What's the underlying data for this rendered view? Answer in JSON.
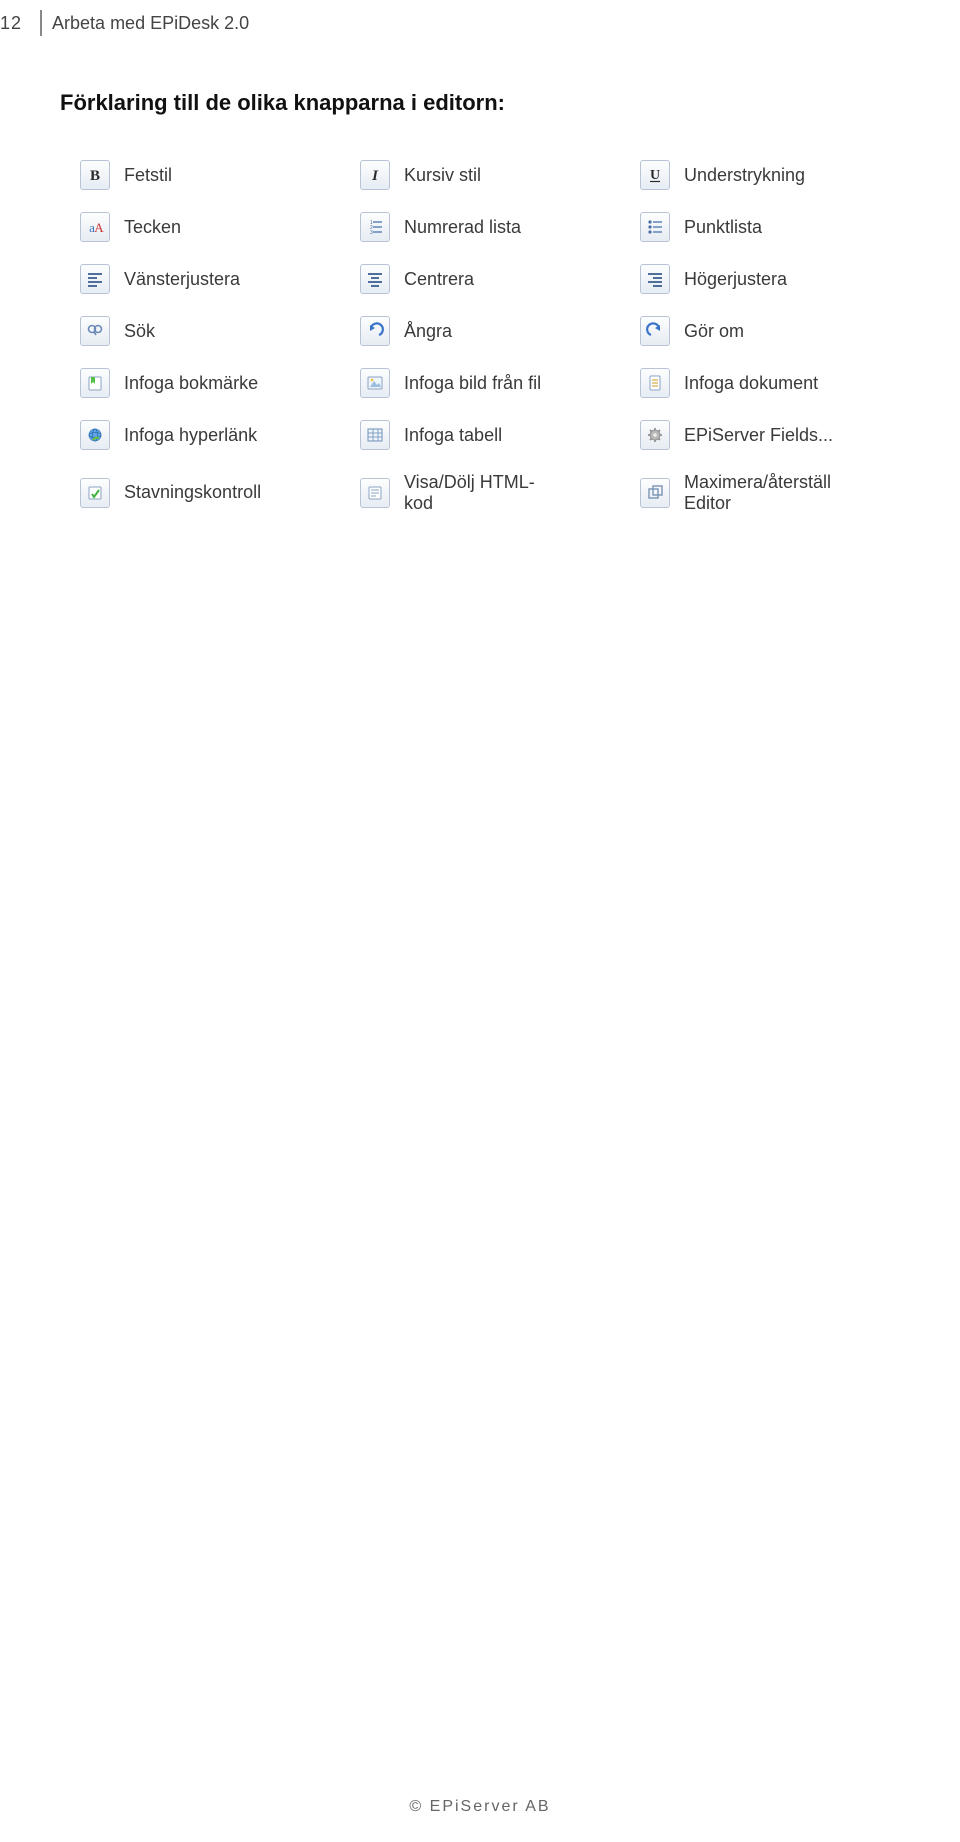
{
  "header": {
    "page_number": "12",
    "title": "Arbeta med EPiDesk 2.0"
  },
  "section_heading": "Förklaring till de olika knapparna i editorn:",
  "rows": [
    {
      "c1": {
        "icon": "bold-icon",
        "label": "Fetstil"
      },
      "c2": {
        "icon": "italic-icon",
        "label": "Kursiv stil"
      },
      "c3": {
        "icon": "underline-icon",
        "label": "Understrykning"
      }
    },
    {
      "c1": {
        "icon": "font-icon",
        "label": "Tecken"
      },
      "c2": {
        "icon": "ordered-list-icon",
        "label": "Numrerad lista"
      },
      "c3": {
        "icon": "bullet-list-icon",
        "label": "Punktlista"
      }
    },
    {
      "c1": {
        "icon": "align-left-icon",
        "label": "Vänsterjustera"
      },
      "c2": {
        "icon": "align-center-icon",
        "label": "Centrera"
      },
      "c3": {
        "icon": "align-right-icon",
        "label": "Högerjustera"
      }
    },
    {
      "c1": {
        "icon": "search-icon",
        "label": "Sök"
      },
      "c2": {
        "icon": "undo-icon",
        "label": "Ångra"
      },
      "c3": {
        "icon": "redo-icon",
        "label": "Gör om"
      }
    },
    {
      "c1": {
        "icon": "bookmark-icon",
        "label": "Infoga bokmärke"
      },
      "c2": {
        "icon": "image-icon",
        "label": "Infoga bild från fil"
      },
      "c3": {
        "icon": "document-icon",
        "label": "Infoga dokument"
      }
    },
    {
      "c1": {
        "icon": "hyperlink-icon",
        "label": "Infoga hyperlänk"
      },
      "c2": {
        "icon": "table-icon",
        "label": "Infoga tabell"
      },
      "c3": {
        "icon": "gear-icon",
        "label": "EPiServer Fields..."
      }
    },
    {
      "c1": {
        "icon": "spellcheck-icon",
        "label": "Stavningskontroll"
      },
      "c2": {
        "icon": "html-toggle-icon",
        "label": "Visa/Dölj HTML-\nkod"
      },
      "c3": {
        "icon": "maximize-icon",
        "label": "Maximera/återställ\nEditor"
      }
    }
  ],
  "footer": "© EPiServer AB"
}
